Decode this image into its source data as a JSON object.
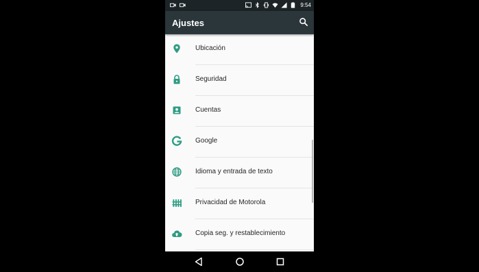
{
  "status_bar": {
    "time": "9:54",
    "icons_left": [
      "video-camera-icon",
      "video-camera-icon"
    ],
    "icons_right": [
      "cast-icon",
      "bluetooth-icon",
      "vibrate-icon",
      "wifi-icon",
      "signal-icon",
      "battery-icon"
    ]
  },
  "toolbar": {
    "title": "Ajustes",
    "search_icon": "search-icon"
  },
  "settings": {
    "items": [
      {
        "label": "Ubicación",
        "icon": "location-pin-icon"
      },
      {
        "label": "Seguridad",
        "icon": "lock-icon"
      },
      {
        "label": "Cuentas",
        "icon": "account-box-icon"
      },
      {
        "label": "Google",
        "icon": "google-icon"
      },
      {
        "label": "Idioma y entrada de texto",
        "icon": "globe-icon"
      },
      {
        "label": "Privacidad de Motorola",
        "icon": "fence-icon"
      },
      {
        "label": "Copia seg. y restablecimiento",
        "icon": "cloud-upload-icon"
      }
    ]
  },
  "nav_bar": {
    "buttons": [
      "back-icon",
      "home-icon",
      "recents-icon"
    ]
  },
  "colors": {
    "accent": "#2e9c84",
    "toolbar": "#2b363b",
    "status_bar": "#1c2427",
    "background": "#fafafa"
  }
}
